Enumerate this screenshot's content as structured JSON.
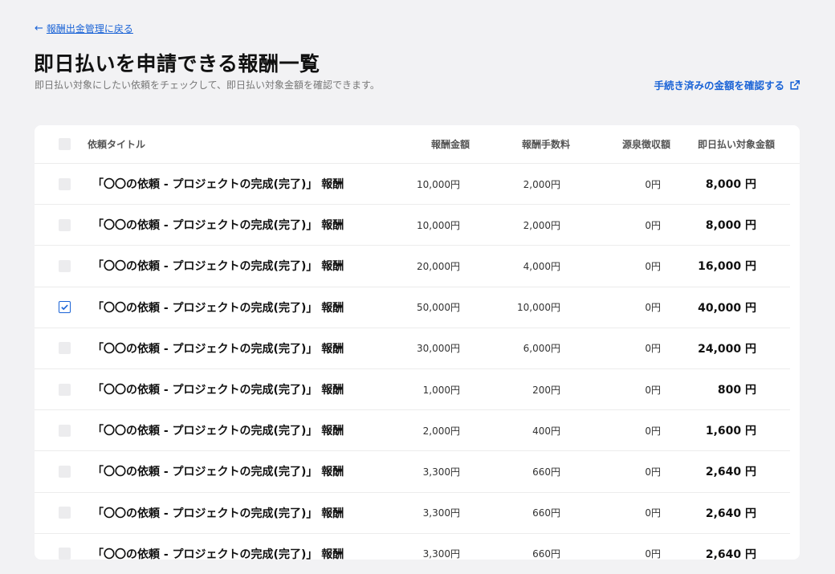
{
  "nav": {
    "back_arrow": "←",
    "back_label": "報酬出金管理に戻る"
  },
  "header": {
    "title": "即日払いを申請できる報酬一覧",
    "subtitle": "即日払い対象にしたい依頼をチェックして、即日払い対象金額を確認できます。",
    "confirm_link": "手続き済みの金額を確認する",
    "confirm_icon": "external-link-icon"
  },
  "colors": {
    "accent": "#1a63d6",
    "background": "#f2f2f4",
    "card": "#ffffff"
  },
  "table": {
    "columns": {
      "title": "依頼タイトル",
      "amount": "報酬金額",
      "fee": "報酬手数料",
      "tax": "源泉徴収額",
      "target": "即日払い対象金額"
    },
    "rows": [
      {
        "checked": false,
        "title": "「〇〇の依頼 - プロジェクトの完成(完了)」 報酬",
        "amount": "10,000円",
        "fee": "2,000円",
        "tax": "0円",
        "target": "8,000 円"
      },
      {
        "checked": false,
        "title": "「〇〇の依頼 - プロジェクトの完成(完了)」 報酬",
        "amount": "10,000円",
        "fee": "2,000円",
        "tax": "0円",
        "target": "8,000 円"
      },
      {
        "checked": false,
        "title": "「〇〇の依頼 - プロジェクトの完成(完了)」 報酬",
        "amount": "20,000円",
        "fee": "4,000円",
        "tax": "0円",
        "target": "16,000 円"
      },
      {
        "checked": true,
        "title": "「〇〇の依頼 - プロジェクトの完成(完了)」 報酬",
        "amount": "50,000円",
        "fee": "10,000円",
        "tax": "0円",
        "target": "40,000 円"
      },
      {
        "checked": false,
        "title": "「〇〇の依頼 - プロジェクトの完成(完了)」 報酬",
        "amount": "30,000円",
        "fee": "6,000円",
        "tax": "0円",
        "target": "24,000 円"
      },
      {
        "checked": false,
        "title": "「〇〇の依頼 - プロジェクトの完成(完了)」 報酬",
        "amount": "1,000円",
        "fee": "200円",
        "tax": "0円",
        "target": "800 円"
      },
      {
        "checked": false,
        "title": "「〇〇の依頼 - プロジェクトの完成(完了)」 報酬",
        "amount": "2,000円",
        "fee": "400円",
        "tax": "0円",
        "target": "1,600 円"
      },
      {
        "checked": false,
        "title": "「〇〇の依頼 - プロジェクトの完成(完了)」 報酬",
        "amount": "3,300円",
        "fee": "660円",
        "tax": "0円",
        "target": "2,640 円"
      },
      {
        "checked": false,
        "title": "「〇〇の依頼 - プロジェクトの完成(完了)」 報酬",
        "amount": "3,300円",
        "fee": "660円",
        "tax": "0円",
        "target": "2,640 円"
      },
      {
        "checked": false,
        "title": "「〇〇の依頼 - プロジェクトの完成(完了)」 報酬",
        "amount": "3,300円",
        "fee": "660円",
        "tax": "0円",
        "target": "2,640 円"
      }
    ]
  }
}
